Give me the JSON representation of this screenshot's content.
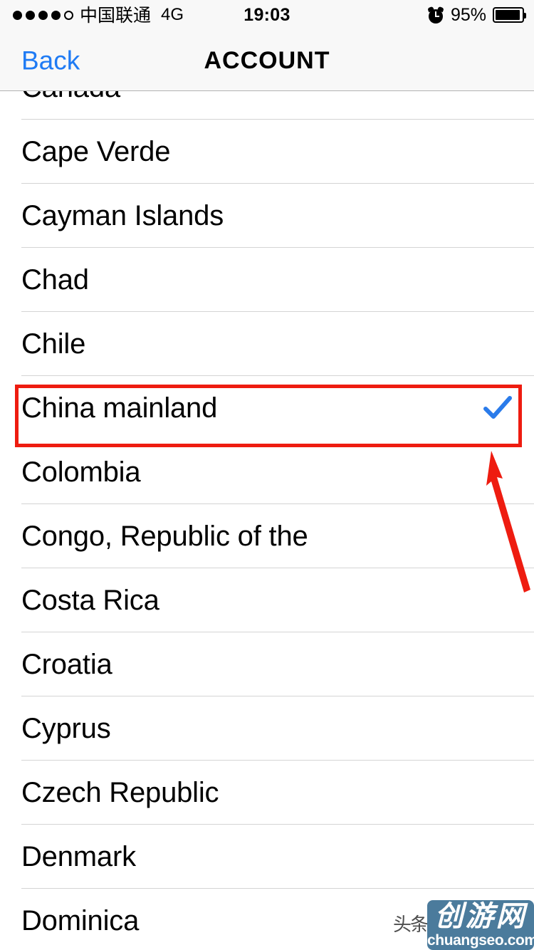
{
  "status_bar": {
    "signal_dots_total": 5,
    "signal_dots_filled": 4,
    "carrier": "中国联通",
    "network_type": "4G",
    "time": "19:03",
    "alarm_icon": "alarm-clock-icon",
    "battery_percent": "95%",
    "battery_level": 95
  },
  "nav_bar": {
    "back_label": "Back",
    "title": "ACCOUNT"
  },
  "list": {
    "rows": [
      {
        "label": "Canada",
        "selected": false
      },
      {
        "label": "Cape Verde",
        "selected": false
      },
      {
        "label": "Cayman Islands",
        "selected": false
      },
      {
        "label": "Chad",
        "selected": false
      },
      {
        "label": "Chile",
        "selected": false
      },
      {
        "label": "China mainland",
        "selected": true
      },
      {
        "label": "Colombia",
        "selected": false
      },
      {
        "label": "Congo, Republic of the",
        "selected": false
      },
      {
        "label": "Costa Rica",
        "selected": false
      },
      {
        "label": "Croatia",
        "selected": false
      },
      {
        "label": "Cyprus",
        "selected": false
      },
      {
        "label": "Czech Republic",
        "selected": false
      },
      {
        "label": "Denmark",
        "selected": false
      },
      {
        "label": "Dominica",
        "selected": false
      }
    ],
    "checkmark_icon": "checkmark-icon"
  },
  "annotations": {
    "highlight_target": "China mainland",
    "arrow_icon": "red-arrow-icon"
  },
  "watermark": {
    "source_label": "头条",
    "brand": "创游网",
    "url": "chuangseo.com"
  },
  "colors": {
    "accent_blue": "#1f7bf4",
    "checkmark_blue": "#2a7bea",
    "annotation_red": "#ee1c10",
    "watermark_badge": "#4b7b9c",
    "bar_background": "#f8f8f8",
    "separator": "#d4d4d4"
  }
}
